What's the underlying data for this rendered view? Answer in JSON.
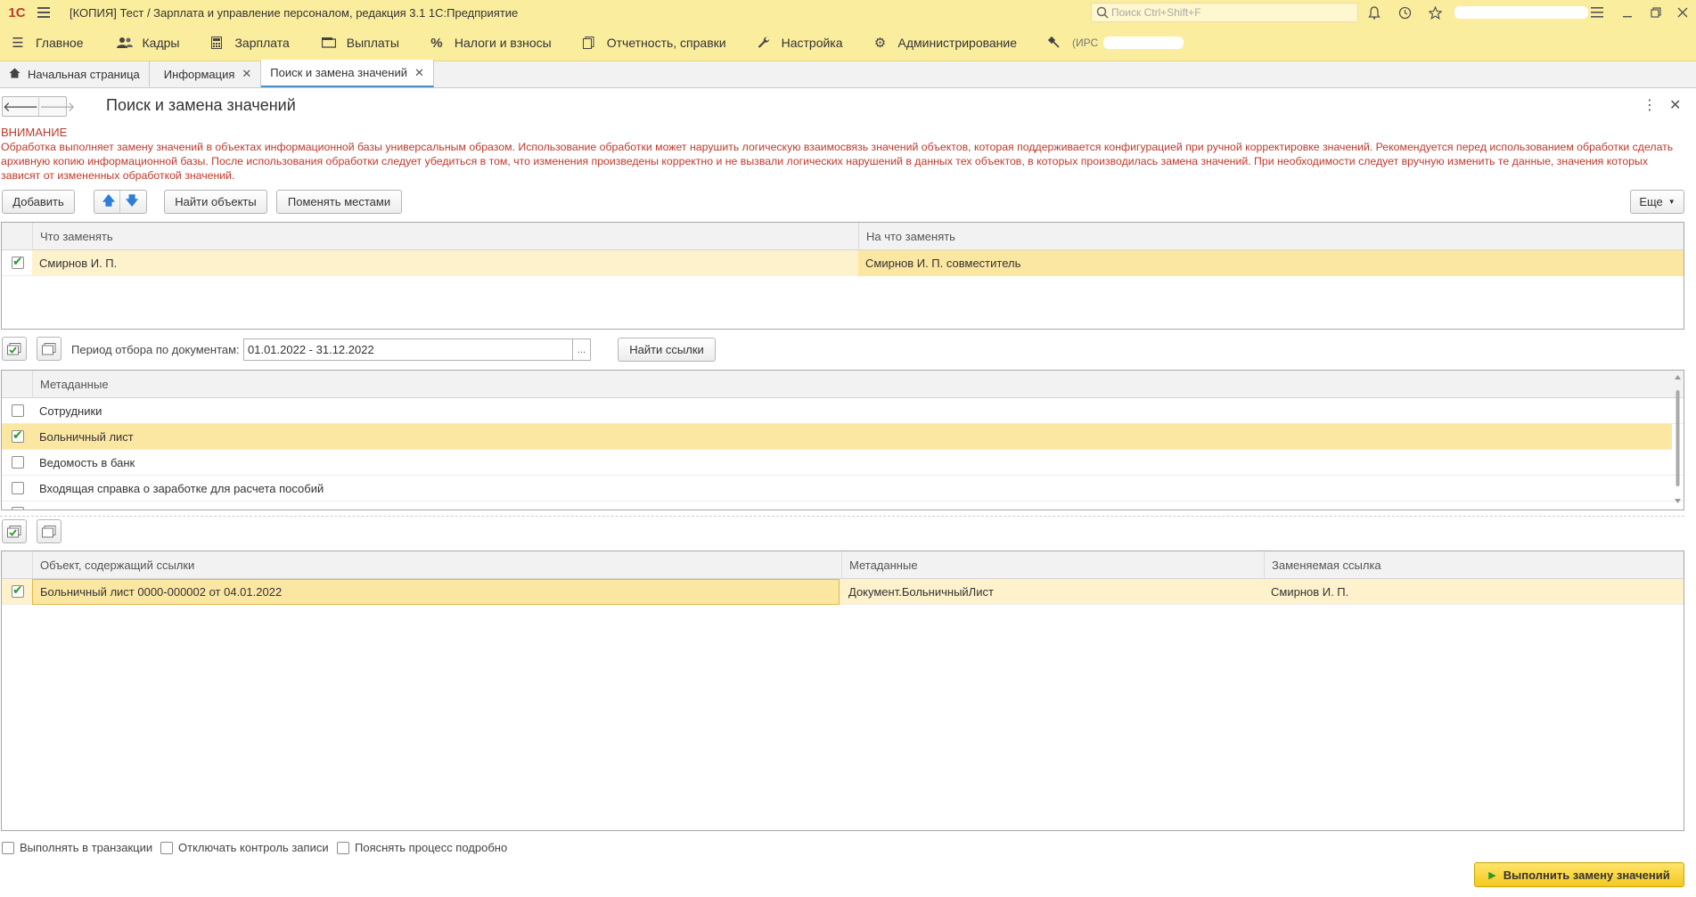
{
  "window": {
    "logo": "1С",
    "title": "[КОПИЯ] Тест / Зарплата и управление персоналом, редакция 3.1 1С:Предприятие",
    "search_placeholder": "Поиск Ctrl+Shift+F"
  },
  "menu": [
    {
      "label": "Главное",
      "icon": "hamburger-icon"
    },
    {
      "label": "Кадры",
      "icon": "people-icon"
    },
    {
      "label": "Зарплата",
      "icon": "calculator-icon"
    },
    {
      "label": "Выплаты",
      "icon": "wallet-icon"
    },
    {
      "label": "Налоги и взносы",
      "icon": "percent-icon"
    },
    {
      "label": "Отчетность, справки",
      "icon": "reports-icon"
    },
    {
      "label": "Настройка",
      "icon": "wrench-icon"
    },
    {
      "label": "Администрирование",
      "icon": "gear-icon"
    },
    {
      "label": "(ИРС",
      "icon": "tool-icon"
    }
  ],
  "tabs": [
    {
      "label": "Начальная страница",
      "closable": false
    },
    {
      "label": "Информация",
      "closable": true
    },
    {
      "label": "Поиск и замена значений",
      "closable": true,
      "active": true
    }
  ],
  "form": {
    "title": "Поиск и замена значений",
    "warning_title": "ВНИМАНИЕ",
    "warning_text": "Обработка выполняет замену значений в объектах информационной базы универсальным образом.  Использование обработки может нарушить логическую взаимосвязь значений объектов, которая поддерживается конфигурацией при ручной корректировке значений. Рекомендуется перед использованием обработки сделать архивную копию информационной базы. После использования обработки следует убедиться в том, что изменения произведены корректно и не вызвали логических нарушений в данных тех объектов, в которых производилась замена значений. При необходимости следует вручную изменить те данные, значения которых зависят от измененных обработкой значений."
  },
  "toolbar": {
    "add": "Добавить",
    "find_objects": "Найти объекты",
    "swap": "Поменять местами",
    "more": "Еще"
  },
  "replace_table": {
    "col_what": "Что заменять",
    "col_to": "На что заменять",
    "rows": [
      {
        "checked": true,
        "what": "Смирнов И. П.",
        "to": "Смирнов И. П. совместитель"
      }
    ]
  },
  "period": {
    "label": "Период отбора по документам:",
    "value": "01.01.2022 - 31.12.2022",
    "select_btn": "...",
    "find_links": "Найти ссылки"
  },
  "metadata_table": {
    "col": "Метаданные",
    "rows": [
      {
        "checked": false,
        "name": "Сотрудники"
      },
      {
        "checked": true,
        "name": "Больничный лист"
      },
      {
        "checked": false,
        "name": "Ведомость в банк"
      },
      {
        "checked": false,
        "name": "Входящая справка о заработке для расчета пособий"
      }
    ]
  },
  "links_table": {
    "col_object": "Объект, содержащий ссылки",
    "col_meta": "Метаданные",
    "col_link": "Заменяемая ссылка",
    "rows": [
      {
        "checked": true,
        "object": "Больничный лист 0000-000002 от 04.01.2022",
        "meta": "Документ.БольничныйЛист",
        "link": "Смирнов И. П."
      }
    ]
  },
  "options": {
    "transaction": "Выполнять в транзакции",
    "disable_control": "Отключать контроль записи",
    "verbose": "Пояснять процесс подробно"
  },
  "run_button": "Выполнить замену значений"
}
